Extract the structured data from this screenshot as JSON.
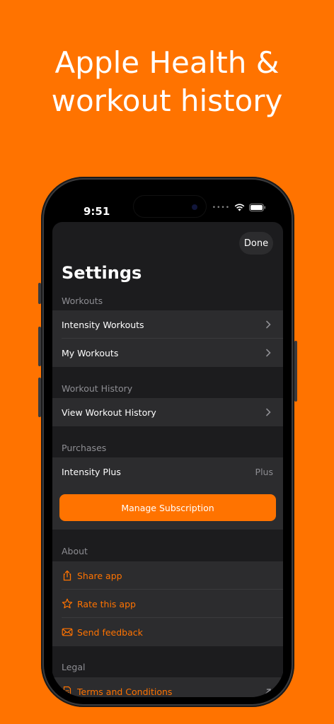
{
  "headline": {
    "line1": "Apple Health &",
    "line2": "workout history"
  },
  "status_bar": {
    "time": "9:51"
  },
  "sheet": {
    "done_label": "Done",
    "title": "Settings",
    "sections": {
      "workouts": {
        "header": "Workouts",
        "items": [
          {
            "label": "Intensity Workouts"
          },
          {
            "label": "My Workouts"
          }
        ]
      },
      "history": {
        "header": "Workout History",
        "items": [
          {
            "label": "View Workout History"
          }
        ]
      },
      "purchases": {
        "header": "Purchases",
        "plan_label": "Intensity Plus",
        "plan_value": "Plus",
        "manage_label": "Manage Subscription"
      },
      "about": {
        "header": "About",
        "items": [
          {
            "label": "Share app",
            "icon": "share-icon"
          },
          {
            "label": "Rate this app",
            "icon": "star-icon"
          },
          {
            "label": "Send feedback",
            "icon": "envelope-icon"
          }
        ]
      },
      "legal": {
        "header": "Legal",
        "items": [
          {
            "label": "Terms and Conditions",
            "icon": "document-icon"
          }
        ]
      }
    }
  },
  "colors": {
    "accent": "#FF7300",
    "background": "#FF7300",
    "sheet": "#1c1c1e",
    "row": "#2c2c2e"
  }
}
